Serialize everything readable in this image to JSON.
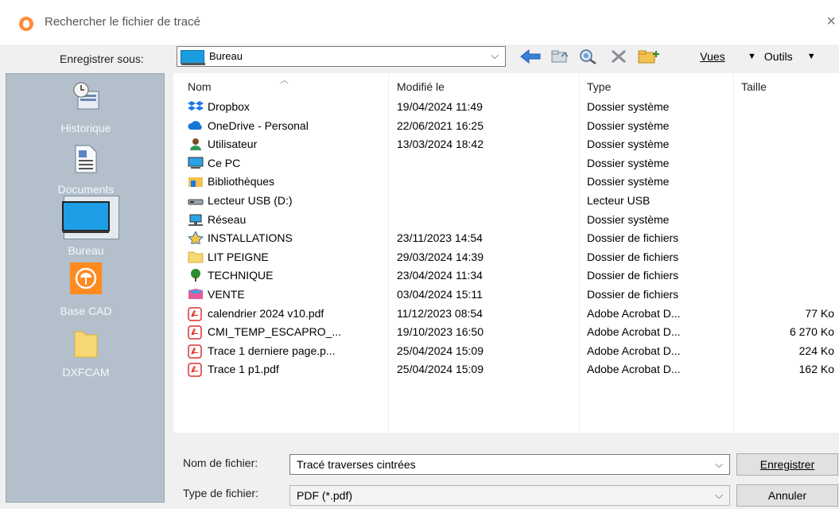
{
  "window": {
    "title": "Rechercher le fichier de tracé",
    "close_glyph": "×"
  },
  "toolbar": {
    "save_in_label": "Enregistrer sous:",
    "location": "Bureau",
    "vues_label": "Vues",
    "outils_label": "Outils"
  },
  "places": [
    {
      "label": "Historique",
      "icon": "history-icon"
    },
    {
      "label": "Documents",
      "icon": "documents-icon"
    },
    {
      "label": "Bureau",
      "icon": "desktop-icon",
      "selected": true
    },
    {
      "label": "Base CAD",
      "icon": "base-cad-icon"
    },
    {
      "label": "DXFCAM",
      "icon": "folder-icon"
    }
  ],
  "columns": {
    "name": "Nom",
    "modified": "Modifié le",
    "type": "Type",
    "size": "Taille"
  },
  "files": [
    {
      "name": "Dropbox",
      "modified": "19/04/2024 11:49",
      "type": "Dossier système",
      "size": "",
      "icon": "dropbox-icon"
    },
    {
      "name": "OneDrive - Personal",
      "modified": "22/06/2021 16:25",
      "type": "Dossier système",
      "size": "",
      "icon": "onedrive-icon"
    },
    {
      "name": "Utilisateur",
      "modified": "13/03/2024 18:42",
      "type": "Dossier système",
      "size": "",
      "icon": "user-icon"
    },
    {
      "name": "Ce PC",
      "modified": "",
      "type": "Dossier système",
      "size": "",
      "icon": "pc-icon"
    },
    {
      "name": "Bibliothèques",
      "modified": "",
      "type": "Dossier système",
      "size": "",
      "icon": "library-icon"
    },
    {
      "name": "Lecteur USB (D:)",
      "modified": "",
      "type": "Lecteur USB",
      "size": "",
      "icon": "usb-drive-icon"
    },
    {
      "name": "Réseau",
      "modified": "",
      "type": "Dossier système",
      "size": "",
      "icon": "network-icon"
    },
    {
      "name": "INSTALLATIONS",
      "modified": "23/11/2023 14:54",
      "type": "Dossier de fichiers",
      "size": "",
      "icon": "star-folder-icon"
    },
    {
      "name": "LIT PEIGNE",
      "modified": "29/03/2024 14:39",
      "type": "Dossier de fichiers",
      "size": "",
      "icon": "folder-icon"
    },
    {
      "name": "TECHNIQUE",
      "modified": "23/04/2024 11:34",
      "type": "Dossier de fichiers",
      "size": "",
      "icon": "tree-icon"
    },
    {
      "name": "VENTE",
      "modified": "03/04/2024 15:11",
      "type": "Dossier de fichiers",
      "size": "",
      "icon": "colorful-folder-icon"
    },
    {
      "name": "calendrier 2024 v10.pdf",
      "modified": "11/12/2023 08:54",
      "type": "Adobe Acrobat D...",
      "size": "77 Ko",
      "icon": "pdf-icon"
    },
    {
      "name": "CMI_TEMP_ESCAPRO_...",
      "modified": "19/10/2023 16:50",
      "type": "Adobe Acrobat D...",
      "size": "6 270 Ko",
      "icon": "pdf-icon"
    },
    {
      "name": "Trace 1 derniere page.p...",
      "modified": "25/04/2024 15:09",
      "type": "Adobe Acrobat D...",
      "size": "224 Ko",
      "icon": "pdf-icon"
    },
    {
      "name": "Trace 1 p1.pdf",
      "modified": "25/04/2024 15:09",
      "type": "Adobe Acrobat D...",
      "size": "162 Ko",
      "icon": "pdf-icon"
    }
  ],
  "filename": {
    "label": "Nom de fichier:",
    "value": "Tracé traverses cintrées"
  },
  "filetype": {
    "label": "Type de fichier:",
    "value": "PDF (*.pdf)"
  },
  "buttons": {
    "save": "Enregistrer",
    "cancel": "Annuler"
  },
  "colors": {
    "places_bg": "#b3c0cb",
    "accent_orange": "#ff8a3d",
    "pdf_red": "#d9322f"
  }
}
